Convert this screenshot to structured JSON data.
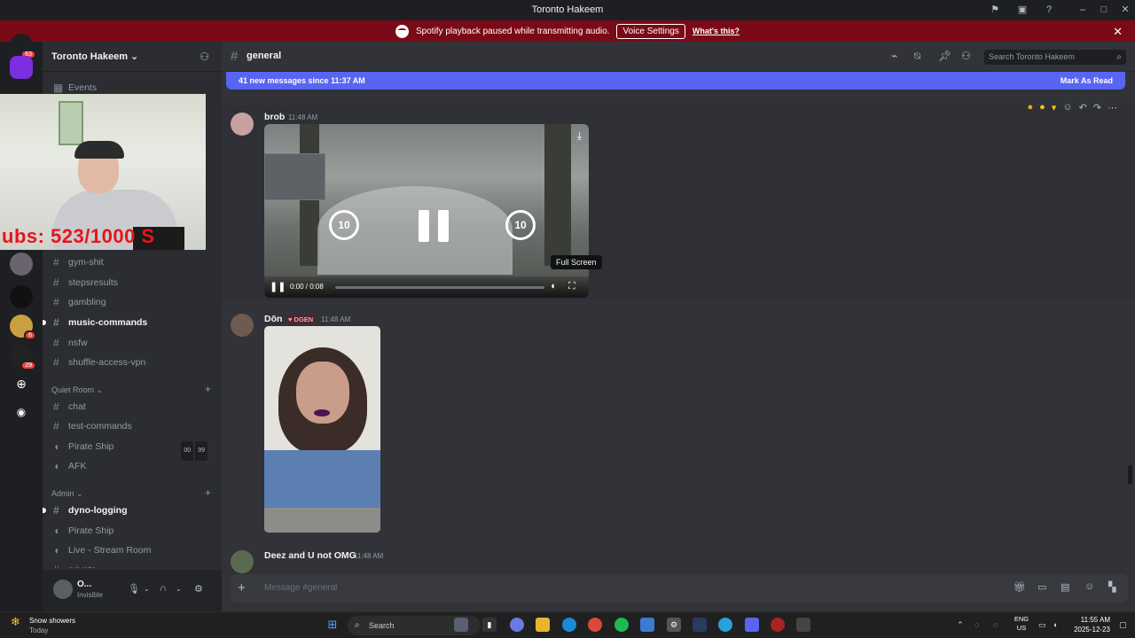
{
  "window": {
    "title": "Toronto Hakeem"
  },
  "notice": {
    "text": "Spotify playback paused while transmitting audio.",
    "button": "Voice Settings",
    "link": "What's this?"
  },
  "server": {
    "name": "Toronto Hakeem"
  },
  "rail": {
    "badges": [
      "63",
      "6",
      "29"
    ]
  },
  "sidebar": {
    "events_label": "Events",
    "channels": [
      {
        "name": "gym-shit"
      },
      {
        "name": "stepsresults"
      },
      {
        "name": "gambling"
      },
      {
        "name": "music-commands"
      },
      {
        "name": "nsfw"
      },
      {
        "name": "shuffle-access-vpn"
      }
    ],
    "quiet_room": {
      "label": "Quiet Room",
      "items": [
        "chat",
        "test-commands",
        "Pirate Ship",
        "AFK"
      ],
      "voice_badges": [
        "00",
        "99"
      ]
    },
    "admin": {
      "label": "Admin",
      "items": [
        "dyno-logging",
        "Pirate Ship",
        "Live - Stream Room",
        "private"
      ]
    }
  },
  "user": {
    "name": "O...",
    "status": "Invisible"
  },
  "webcam": {
    "overlay_text": "ubs: 523/1000  S"
  },
  "channel": {
    "name": "general",
    "search_placeholder": "Search Toronto Hakeem"
  },
  "new_messages": {
    "text": "41 new messages since 11:37 AM",
    "action": "Mark As Read"
  },
  "messages": [
    {
      "author": "brob",
      "time": "11:48 AM",
      "video": {
        "time": "0:00 / 0:08",
        "progress": 0.0,
        "rewind": "10",
        "forward": "10",
        "tooltip": "Full Screen"
      }
    },
    {
      "author": "Dōn",
      "tag": "DGEN",
      "time": "11:48 AM"
    },
    {
      "author": "Deez and U not OMG",
      "time": "11:48 AM"
    }
  ],
  "composer": {
    "placeholder": "Message #general"
  },
  "taskbar": {
    "weather": {
      "title": "Snow showers",
      "subtitle": "Today"
    },
    "search": "Search",
    "lang": {
      "line1": "ENG",
      "line2": "US"
    },
    "clock": {
      "time": "11:55 AM",
      "date": "2025-12-23"
    }
  },
  "colors": {
    "accent": "#5865f2",
    "notice_bg": "#7a0a17",
    "webcam_text": "#e8141c"
  }
}
